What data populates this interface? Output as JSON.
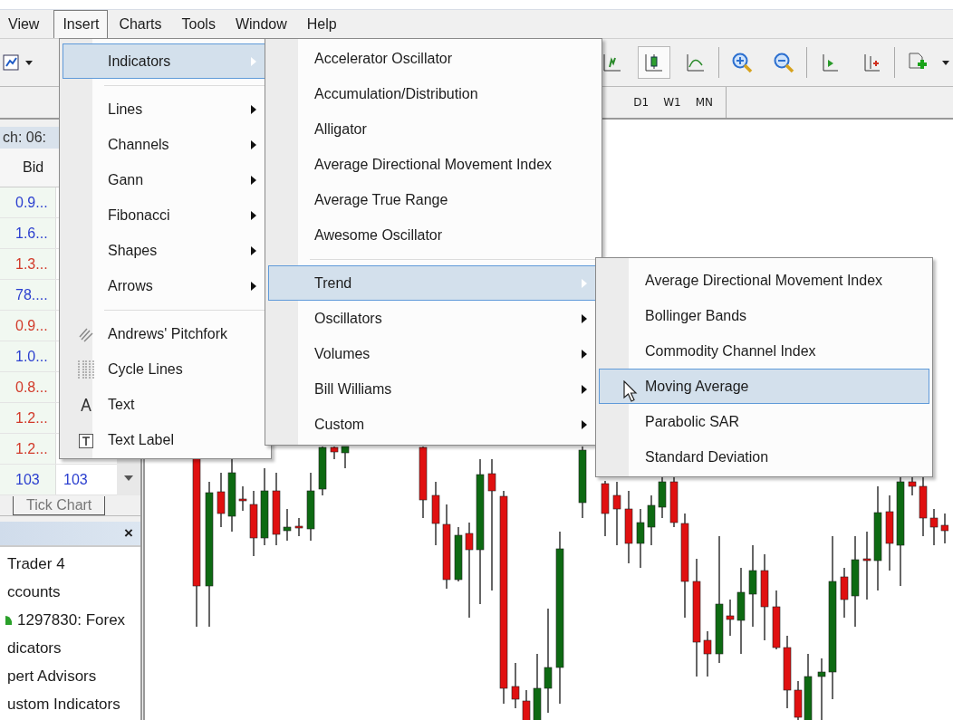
{
  "menu_bar": [
    {
      "label": "View",
      "selected": false
    },
    {
      "label": "Insert",
      "selected": true
    },
    {
      "label": "Charts",
      "selected": false
    },
    {
      "label": "Tools",
      "selected": false
    },
    {
      "label": "Window",
      "selected": false
    },
    {
      "label": "Help",
      "selected": false
    }
  ],
  "toolbar_buttons": [
    {
      "selected": false
    },
    {
      "selected": true
    },
    {
      "selected": false
    },
    {
      "selected": false
    },
    {
      "selected": false
    },
    {
      "selected": false
    },
    {
      "selected": false
    },
    {
      "selected": false
    }
  ],
  "timeframes": [
    "D1",
    "W1",
    "MN"
  ],
  "market_watch": {
    "title": "ch: 06:",
    "column": "Bid",
    "rows": [
      {
        "bid": "0.9...",
        "color": "#2b3fcf"
      },
      {
        "bid": "1.6...",
        "color": "#2b3fcf"
      },
      {
        "bid": "1.3...",
        "color": "#d23a2a"
      },
      {
        "bid": "78....",
        "color": "#2b3fcf"
      },
      {
        "bid": "0.9...",
        "color": "#d23a2a"
      },
      {
        "bid": "1.0...",
        "color": "#2b3fcf"
      },
      {
        "bid": "0.8...",
        "color": "#d23a2a"
      },
      {
        "bid": "1.2...",
        "color": "#d23a2a"
      },
      {
        "bid": "1.2...",
        "color": "#d23a2a"
      },
      {
        "bid": "103",
        "ask": "103",
        "color": "#2b3fcf"
      }
    ],
    "tab": "Tick Chart"
  },
  "navigator": {
    "close": "×",
    "items": [
      {
        "label": "Trader 4"
      },
      {
        "label": "ccounts",
        "children": [
          {
            "label": "1297830: Forex"
          }
        ]
      },
      {
        "label": "dicators"
      },
      {
        "label": "pert Advisors"
      },
      {
        "label": "ustom Indicators"
      }
    ]
  },
  "insert_menu": [
    {
      "kind": "item",
      "label": "Indicators",
      "submenu": true,
      "selected": true
    },
    {
      "kind": "separator"
    },
    {
      "kind": "item",
      "label": "Lines",
      "submenu": true,
      "selected": false
    },
    {
      "kind": "item",
      "label": "Channels",
      "submenu": true,
      "selected": false
    },
    {
      "kind": "item",
      "label": "Gann",
      "submenu": true,
      "selected": false
    },
    {
      "kind": "item",
      "label": "Fibonacci",
      "submenu": true,
      "selected": false
    },
    {
      "kind": "item",
      "label": "Shapes",
      "submenu": true,
      "selected": false
    },
    {
      "kind": "item",
      "label": "Arrows",
      "submenu": true,
      "selected": false
    },
    {
      "kind": "separator"
    },
    {
      "kind": "tool",
      "label": "Andrews' Pitchfork",
      "submenu": false,
      "selected": false
    },
    {
      "kind": "tool",
      "label": "Cycle Lines",
      "submenu": false,
      "selected": false
    },
    {
      "kind": "tool",
      "label": "Text",
      "submenu": false,
      "selected": false
    },
    {
      "kind": "tool",
      "label": "Text Label",
      "submenu": false,
      "selected": false
    }
  ],
  "indicators_menu": [
    {
      "kind": "item",
      "label": "Accelerator Oscillator",
      "submenu": false,
      "selected": false
    },
    {
      "kind": "item",
      "label": "Accumulation/Distribution",
      "submenu": false,
      "selected": false
    },
    {
      "kind": "item",
      "label": "Alligator",
      "submenu": false,
      "selected": false
    },
    {
      "kind": "item",
      "label": "Average Directional Movement Index",
      "submenu": false,
      "selected": false
    },
    {
      "kind": "item",
      "label": "Average True Range",
      "submenu": false,
      "selected": false
    },
    {
      "kind": "item",
      "label": "Awesome Oscillator",
      "submenu": false,
      "selected": false
    },
    {
      "kind": "separator"
    },
    {
      "kind": "item",
      "label": "Trend",
      "submenu": true,
      "selected": true
    },
    {
      "kind": "item",
      "label": "Oscillators",
      "submenu": true,
      "selected": false
    },
    {
      "kind": "item",
      "label": "Volumes",
      "submenu": true,
      "selected": false
    },
    {
      "kind": "item",
      "label": "Bill Williams",
      "submenu": true,
      "selected": false
    },
    {
      "kind": "item",
      "label": "Custom",
      "submenu": true,
      "selected": false
    }
  ],
  "trend_menu": [
    {
      "kind": "item",
      "label": "Average Directional Movement Index",
      "submenu": false,
      "selected": false
    },
    {
      "kind": "item",
      "label": "Bollinger Bands",
      "submenu": false,
      "selected": false
    },
    {
      "kind": "item",
      "label": "Commodity Channel Index",
      "submenu": false,
      "selected": false
    },
    {
      "kind": "item",
      "label": "Moving Average",
      "submenu": false,
      "selected": true
    },
    {
      "kind": "item",
      "label": "Parabolic SAR",
      "submenu": false,
      "selected": false
    },
    {
      "kind": "item",
      "label": "Standard Deviation",
      "submenu": false,
      "selected": false
    }
  ]
}
